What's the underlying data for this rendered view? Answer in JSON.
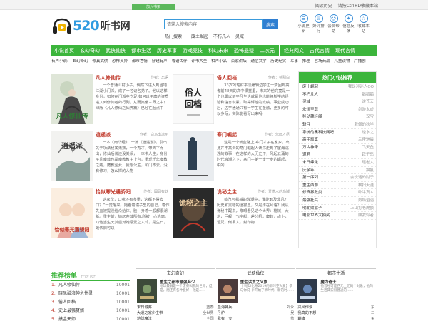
{
  "topbar": {
    "tab_label": "加入书架",
    "history": "阅读历史",
    "bookmark_tip": "请按Ctrl+D收藏本站"
  },
  "logo": {
    "num": "520",
    "cn": "听书网"
  },
  "search": {
    "placeholder": "请输入搜索内容！",
    "button": "搜索"
  },
  "hot": {
    "label": "热门搜索：",
    "items": [
      "废土崛起",
      "不朽凡人",
      "灵域"
    ]
  },
  "quick": [
    {
      "icon": "receipt-icon",
      "glyph": "☰",
      "label": "小说更新"
    },
    {
      "icon": "trophy-icon",
      "glyph": "♕",
      "label": "好评排行"
    },
    {
      "icon": "user-icon",
      "glyph": "☺",
      "label": "会员帮助"
    },
    {
      "icon": "lightbulb-icon",
      "glyph": "✦",
      "label": "信息反馈"
    },
    {
      "icon": "star-icon",
      "glyph": "☆",
      "label": "收藏本站"
    }
  ],
  "nav": {
    "primary": [
      "小说首页",
      "玄幻奇幻",
      "武侠仙侠",
      "都市生活",
      "历史军事",
      "游戏竞技",
      "科幻未来",
      "恐怖悬疑",
      "二次元"
    ],
    "secondary": [
      "经典网文",
      "古代言情",
      "现代言情"
    ]
  },
  "subnav": [
    "有声小说:",
    "玄幻奇幻",
    "修真武侠",
    "恐怖灵异",
    "都市言情",
    "穿越有声",
    "粤语古仔",
    "评书大全",
    "相声小品",
    "百家讲坛",
    "通俗文学",
    "历史纪实",
    "军事",
    "推理",
    "官场商战",
    "儿童读物",
    "广播剧"
  ],
  "books": [
    {
      "title": "凡人修仙传",
      "author": "作者：忘语",
      "desc": "一个普通山村小子，偶然下进入到当地江湖小门派，成了一名记名弟子。他以这样身份，如何在门派中立足,如何以平庸的资质进入到修仙者的行列，从而笑傲三界之中！绿版《凡人修仙之仙界篇》已经在起点中",
      "cover_text": "凡人修仙传"
    },
    {
      "title": "俗人回档",
      "author": "作者：特别白",
      "desc": "33岁的理财平淡编辑边学边一梦回到高考前48天的高中课堂里，未来的他究竟是一个也需以前平凡生活或是他也能将所学的经验和信息积累，取得辉煌的成绩。事业成功后，边学通通只有一学生在金融，更多的可以多写，实际能看写出来吗",
      "cover_text": "俗人回档"
    },
    {
      "title": "逍遥派",
      "author": "作者：白马出凉州",
      "desc": "一本《南华经》，一篇《逍遥游》，引出关于功法秘笈无数，一个秀才，带天下而出，修仙后装还没关系，一本书人生，身份平凡魔尊也是魔教教主上台，重现千年魔教之威，魔教圣女，我想公主，和门不去，没有修习，怎么样的人物",
      "cover_text": "逍遥派"
    },
    {
      "title": "寒门崛起",
      "author": "作者：朱郎才尽",
      "desc": "这是一个就业路上,寒门才子在家乡，出身并不高贵的寒门崛起人读书走到了宦海沉浮的故事，在这样的大历史下，风起云涌的时代浪潮之下，寒门子弟一步一步的崛起，中的",
      "cover_text": "寒门崛起"
    },
    {
      "title": "恰似寒光遇骄阳",
      "author": "作者：囧囧有妖",
      "desc": "这家伙，口味还有多重，这都下得去口？”一觉醒来，她看着镜子里的自己，着作失血被提没给众给体，脸，身着一般都很潮新。重生前，她厌弃其所有,所被一心逃离。乃他当生天其后对她恩爱之人却，是生日，她依旧可以",
      "cover_text": "恰似寒光遇骄阳"
    },
    {
      "title": "诡秘之主",
      "author": "作者：爱潜水的乌贼",
      "desc": "蒸汽与机械的浪潮中，谁能触及非凡？历史和黑暗的迷雾里，又是谁在耳语？我从诡秘中醒来，睁眼看见这个世界：枪械，大炮，巨舰，飞空艇，差分机，魔药，占卜，诅咒，倒吊人，封印物……",
      "cover_text": "诡秘之主"
    }
  ],
  "sidebar": {
    "title": "热门小说推荐",
    "rows": [
      {
        "book": "废土崛起",
        "author": "我是迷迷人QO"
      },
      {
        "book": "不朽凡人",
        "author": "鹅鹅鹅"
      },
      {
        "book": "灵域",
        "author": "逆苍天"
      },
      {
        "book": "永恒至尊",
        "author": "剑游太虚"
      },
      {
        "book": "移动藏经阁",
        "author": "汉宝"
      },
      {
        "book": "斩月",
        "author": "戴佩的秋半"
      },
      {
        "book": "系统的黑科技网吧",
        "author": "逆水之"
      },
      {
        "book": "高手寂寞",
        "author": "兰帝魅晨"
      },
      {
        "book": "万古神帝",
        "author": "飞天鱼"
      },
      {
        "book": "道君",
        "author": "跃千愁"
      },
      {
        "book": "末日蜂巢",
        "author": "瑶老大"
      },
      {
        "book": "庆余年",
        "author": "猫腻"
      },
      {
        "book": "第一序列",
        "author": "会说话的肘子"
      },
      {
        "book": "重生西游",
        "author": "横扫天涯"
      },
      {
        "book": "修真界败类",
        "author": "卧牛真人"
      },
      {
        "book": "最强狂兵",
        "author": "烈焰滔滔"
      },
      {
        "book": "明朝败家子",
        "author": "上山打老虎额"
      },
      {
        "book": "电影世界大抽奖",
        "author": "顾我怜者"
      }
    ]
  },
  "rank": {
    "title": "推荐榜单",
    "eng": "TOPLIST",
    "rows": [
      {
        "n": "1.",
        "t": "凡人修仙传",
        "v": "10001"
      },
      {
        "n": "2.",
        "t": "晓凤破浪神之性灵",
        "v": "10001"
      },
      {
        "n": "3.",
        "t": "俗人回档",
        "v": "10001"
      },
      {
        "n": "4.",
        "t": "史上最强赘婿",
        "v": "10001"
      },
      {
        "n": "5.",
        "t": "摸金天师",
        "v": "10001"
      }
    ]
  },
  "cols": [
    {
      "head": "玄幻奇幻",
      "title": "重生之都市最强弃少",
      "desc": "地球最弱是一个废柴叫我的世界，但是，而还有各种极好，他是……",
      "rows": [
        [
          "末日城邦",
          "蓝泰"
        ],
        [
          "大道之家少主带",
          "全世界"
        ],
        [
          "地球魔法",
          "全国"
        ],
        [
          "开局后",
          "不一"
        ]
      ]
    },
    {
      "head": "武侠仙侠",
      "title": "重生洪荒之义旗",
      "desc": "【!地球化身2019的新时空大爱】参与你说【!开始了新时代，新的时……",
      "rows": [
        [
          "血海神兵",
          "刘永"
        ],
        [
          "丹炉",
          "吴"
        ],
        [
          "我有一支",
          "蓝"
        ],
        [
          "开局我",
          "一叶"
        ]
      ]
    },
    {
      "head": "都市生活",
      "title": "魔力奇士",
      "desc": "他曾经可是西元上亿的个对象，他的生活其实很普通的……",
      "rows": [
        [
          "兴风作浪",
          "东"
        ],
        [
          "我真的不想",
          "三"
        ],
        [
          "巅峰",
          "兔"
        ],
        [
          "都市",
          "大"
        ]
      ]
    }
  ]
}
